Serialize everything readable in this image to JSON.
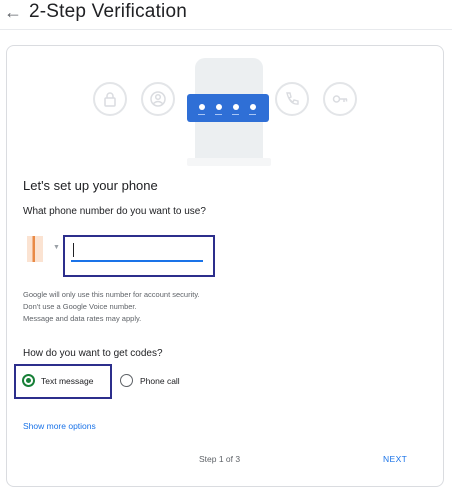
{
  "header": {
    "title": "2-Step Verification",
    "back_icon": "arrow-back-icon"
  },
  "illustration": {
    "icons": [
      "lock-icon",
      "account-circle-icon",
      "phone-icon",
      "key-icon"
    ],
    "pin_color": "#2f6fd6"
  },
  "setup": {
    "heading": "Let's set up your phone",
    "question": "What phone number do you want to use?",
    "phone_value": "",
    "notes": [
      "Google will only use this number for account security.",
      "Don't use a Google Voice number.",
      "Message and data rates may apply."
    ]
  },
  "codes": {
    "question": "How do you want to get codes?",
    "options": [
      {
        "label": "Text message",
        "selected": true
      },
      {
        "label": "Phone call",
        "selected": false
      }
    ]
  },
  "footer": {
    "show_more": "Show more options",
    "step": "Step 1 of 3",
    "next": "NEXT"
  },
  "colors": {
    "accent": "#1a73e8",
    "selected_radio": "#188038",
    "annotation_box": "#2c2e8c"
  }
}
